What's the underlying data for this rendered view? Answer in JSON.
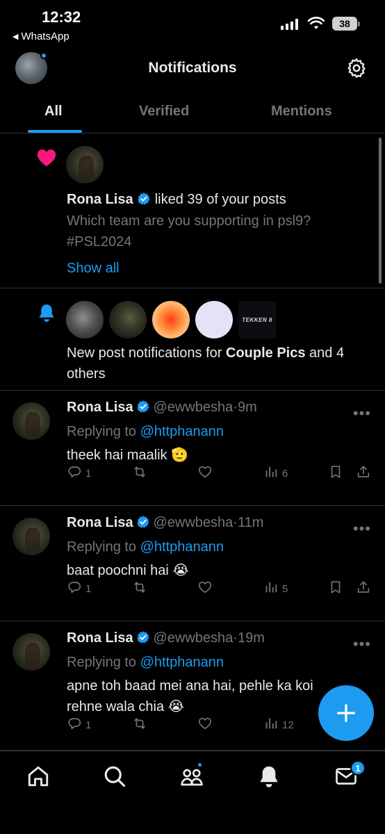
{
  "status_bar": {
    "time": "12:32",
    "back_app": "WhatsApp",
    "battery": "38"
  },
  "header": {
    "title": "Notifications"
  },
  "tabs": [
    {
      "label": "All",
      "active": true
    },
    {
      "label": "Verified",
      "active": false
    },
    {
      "label": "Mentions",
      "active": false
    }
  ],
  "notifications": {
    "like": {
      "user": "Rona Lisa",
      "action": "liked 39 of your posts",
      "post_text": "Which team are you supporting in psl9? #PSL2024",
      "show_all": "Show all"
    },
    "new_posts": {
      "prefix": "New post notifications for",
      "account": "Couple Pics",
      "suffix": "and 4 others",
      "tekken_label": "TEKKEN 8"
    },
    "replies": [
      {
        "name": "Rona Lisa",
        "handle": "@ewwbesha",
        "sep": "·",
        "time": "9m",
        "replying_prefix": "Replying to",
        "replying_to": "@httphanann",
        "text": "theek hai maalik 🫡",
        "replies": "1",
        "retweets": "",
        "likes": "",
        "views": "6"
      },
      {
        "name": "Rona Lisa",
        "handle": "@ewwbesha",
        "sep": "·",
        "time": "11m",
        "replying_prefix": "Replying to",
        "replying_to": "@httphanann",
        "text": "baat poochni hai 😭",
        "replies": "1",
        "retweets": "",
        "likes": "",
        "views": "5"
      },
      {
        "name": "Rona Lisa",
        "handle": "@ewwbesha",
        "sep": "·",
        "time": "19m",
        "replying_prefix": "Replying to",
        "replying_to": "@httphanann",
        "text": "apne toh baad mei ana hai, pehle ka koi rehne wala chia 😭",
        "replies": "1",
        "retweets": "",
        "likes": "",
        "views": "12"
      }
    ]
  },
  "bottom_nav": {
    "messages_badge": "1"
  },
  "colors": {
    "accent": "#1d9bf0",
    "like": "#f91880",
    "muted": "#71767b",
    "background": "#000000"
  }
}
